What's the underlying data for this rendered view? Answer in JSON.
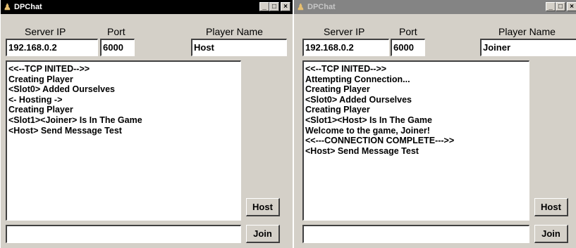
{
  "windows": [
    {
      "title": "DPChat",
      "labels": {
        "server_ip": "Server IP",
        "port": "Port",
        "player_name": "Player Name"
      },
      "server_ip": "192.168.0.2",
      "port": "6000",
      "player_name": "Host",
      "log": [
        "<<--TCP INITED-->>",
        "Creating Player",
        "<Slot0> Added Ourselves",
        "<- Hosting ->",
        "Creating Player",
        "<Slot1><Joiner> Is In The Game",
        "<Host> Send Message Test"
      ],
      "message_input": "",
      "host_button": "Host",
      "join_button": "Join",
      "controls": {
        "minimize": "_",
        "maximize": "□",
        "close": "×"
      }
    },
    {
      "title": "DPChat",
      "labels": {
        "server_ip": "Server IP",
        "port": "Port",
        "player_name": "Player Name"
      },
      "server_ip": "192.168.0.2",
      "port": "6000",
      "player_name": "Joiner",
      "log": [
        "<<--TCP INITED-->>",
        "Attempting Connection...",
        "Creating Player",
        "<Slot0> Added Ourselves",
        "Creating Player",
        "<Slot1><Host> Is In The Game",
        "Welcome to the game, Joiner!",
        "<<---CONNECTION COMPLETE--->>",
        "<Host> Send Message Test"
      ],
      "message_input": "",
      "host_button": "Host",
      "join_button": "Join",
      "controls": {
        "minimize": "_",
        "maximize": "□",
        "close": "×"
      }
    }
  ]
}
